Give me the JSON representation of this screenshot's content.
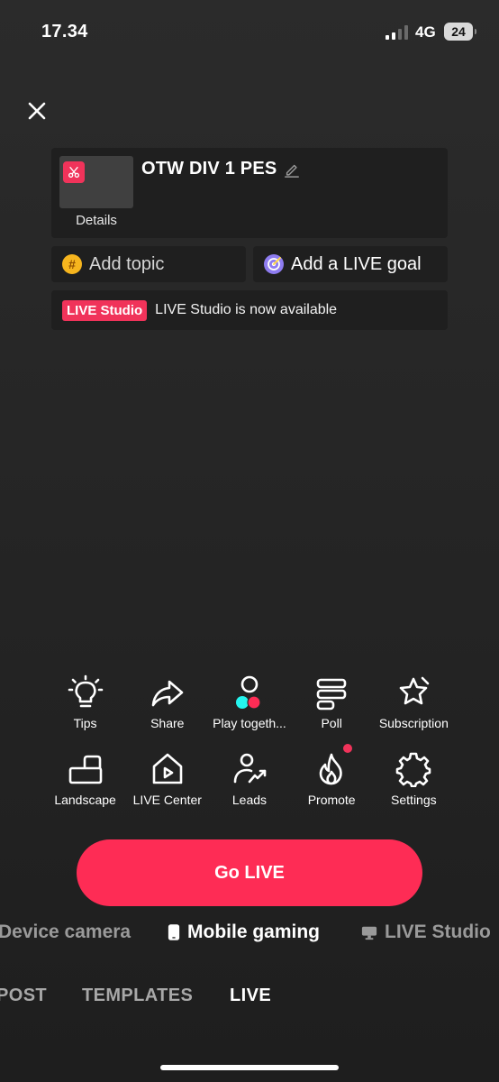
{
  "status_bar": {
    "time": "17.34",
    "network": "4G",
    "battery": "24"
  },
  "details_card": {
    "title": "OTW DIV 1 PES",
    "details_label": "Details"
  },
  "topic_button": {
    "label": "Add topic"
  },
  "goal_button": {
    "label": "Add a LIVE goal"
  },
  "studio_banner": {
    "badge": "LIVE Studio",
    "text": "LIVE Studio is now available"
  },
  "tools_row1": [
    {
      "label": "Tips",
      "icon": "lightbulb-icon"
    },
    {
      "label": "Share",
      "icon": "share-arrow-icon"
    },
    {
      "label": "Play togeth...",
      "icon": "play-together-icon"
    },
    {
      "label": "Poll",
      "icon": "poll-icon"
    },
    {
      "label": "Subscription",
      "icon": "subscription-star-icon"
    }
  ],
  "tools_row2": [
    {
      "label": "Landscape",
      "icon": "landscape-rotate-icon"
    },
    {
      "label": "LIVE Center",
      "icon": "live-center-home-icon"
    },
    {
      "label": "Leads",
      "icon": "leads-person-icon"
    },
    {
      "label": "Promote",
      "icon": "flame-icon"
    },
    {
      "label": "Settings",
      "icon": "gear-icon"
    }
  ],
  "go_live": {
    "label": "Go LIVE"
  },
  "modes": [
    {
      "label": "Device camera",
      "active": false
    },
    {
      "label": "Mobile gaming",
      "active": true
    },
    {
      "label": "LIVE Studio",
      "active": false
    }
  ],
  "tabs": [
    {
      "label": "POST",
      "active": false
    },
    {
      "label": "TEMPLATES",
      "active": false
    },
    {
      "label": "LIVE",
      "active": true
    }
  ],
  "colors": {
    "accent": "#fe2c55",
    "badge": "#f0335a",
    "card": "#1f1f1f"
  }
}
